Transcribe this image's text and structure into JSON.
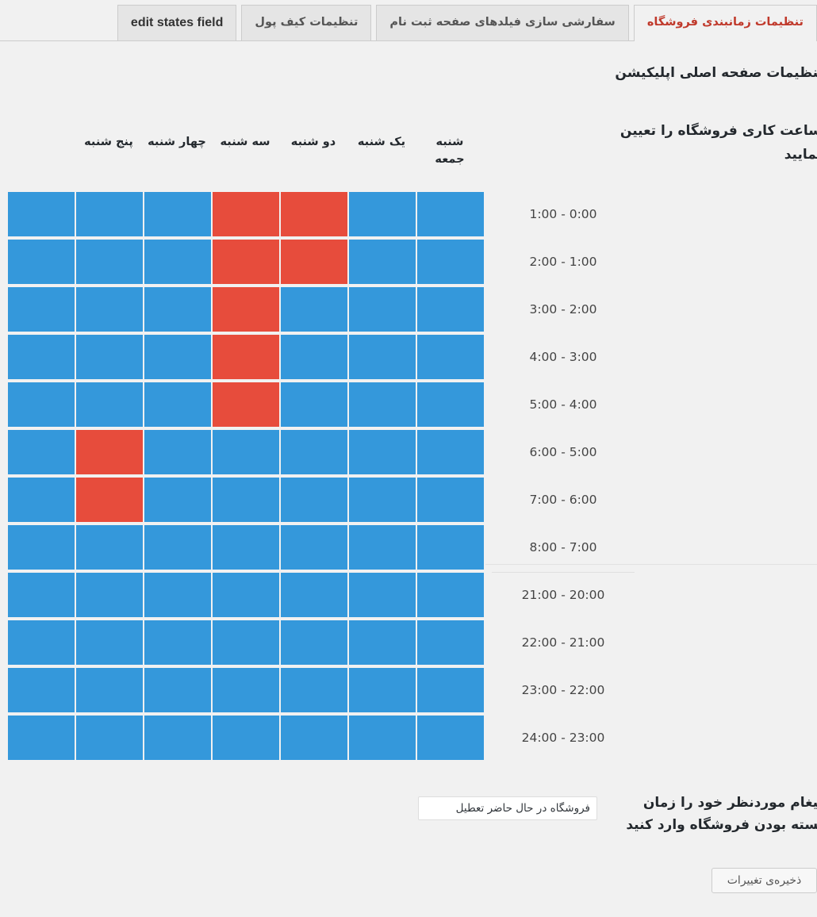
{
  "tabs": [
    {
      "label": "تنظیمات زمانبندی فروشگاه",
      "active": true,
      "latin": false
    },
    {
      "label": "سفارشی سازی فیلدهای صفحه ثبت نام",
      "active": false,
      "latin": false
    },
    {
      "label": "تنظیمات کیف پول",
      "active": false,
      "latin": false
    },
    {
      "label": "edit states field",
      "active": false,
      "latin": true
    }
  ],
  "page": {
    "app_heading": "تنظیمات صفحه اصلی اپلیکیشن",
    "schedule_label": "ساعت کاری فروشگاه را تعیین نمایید",
    "closed_message_label": "پیغام موردنظر خود را زمان بسته بودن فروشگاه وارد کنید"
  },
  "closed_message": {
    "value": "فروشگاه در حال حاضر تعطیل",
    "placeholder": "فروشگاه در حال حاضر تعطیل"
  },
  "save": {
    "label": "ذخیره‌ی تغییرات"
  },
  "colors": {
    "open": "#3498db",
    "closed": "#e74c3c",
    "background": "#f1f1f1",
    "tab_active_text": "#c0392b"
  },
  "schedule": {
    "days": [
      "شنبه",
      "یک شنبه",
      "دو شنبه",
      "سه شنبه",
      "چهار شنبه",
      "پنج شنبه",
      "جمعه"
    ],
    "time_slots": [
      "1:00 - 0:00",
      "2:00 - 1:00",
      "3:00 - 2:00",
      "4:00 - 3:00",
      "5:00 - 4:00",
      "6:00 - 5:00",
      "7:00 - 6:00",
      "8:00 - 7:00",
      "21:00 - 20:00",
      "22:00 - 21:00",
      "23:00 - 22:00",
      "24:00 - 23:00"
    ],
    "divider_after_slot_index": 7,
    "states": [
      [
        "open",
        "open",
        "closed",
        "closed",
        "open",
        "open",
        "open"
      ],
      [
        "open",
        "open",
        "closed",
        "closed",
        "open",
        "open",
        "open"
      ],
      [
        "open",
        "open",
        "open",
        "closed",
        "open",
        "open",
        "open"
      ],
      [
        "open",
        "open",
        "open",
        "closed",
        "open",
        "open",
        "open"
      ],
      [
        "open",
        "open",
        "open",
        "closed",
        "open",
        "open",
        "open"
      ],
      [
        "open",
        "open",
        "open",
        "open",
        "open",
        "closed",
        "open"
      ],
      [
        "open",
        "open",
        "open",
        "open",
        "open",
        "closed",
        "open"
      ],
      [
        "open",
        "open",
        "open",
        "open",
        "open",
        "open",
        "open"
      ],
      [
        "open",
        "open",
        "open",
        "open",
        "open",
        "open",
        "open"
      ],
      [
        "open",
        "open",
        "open",
        "open",
        "open",
        "open",
        "open"
      ],
      [
        "open",
        "open",
        "open",
        "open",
        "open",
        "open",
        "open"
      ],
      [
        "open",
        "open",
        "open",
        "open",
        "open",
        "open",
        "open"
      ]
    ]
  }
}
